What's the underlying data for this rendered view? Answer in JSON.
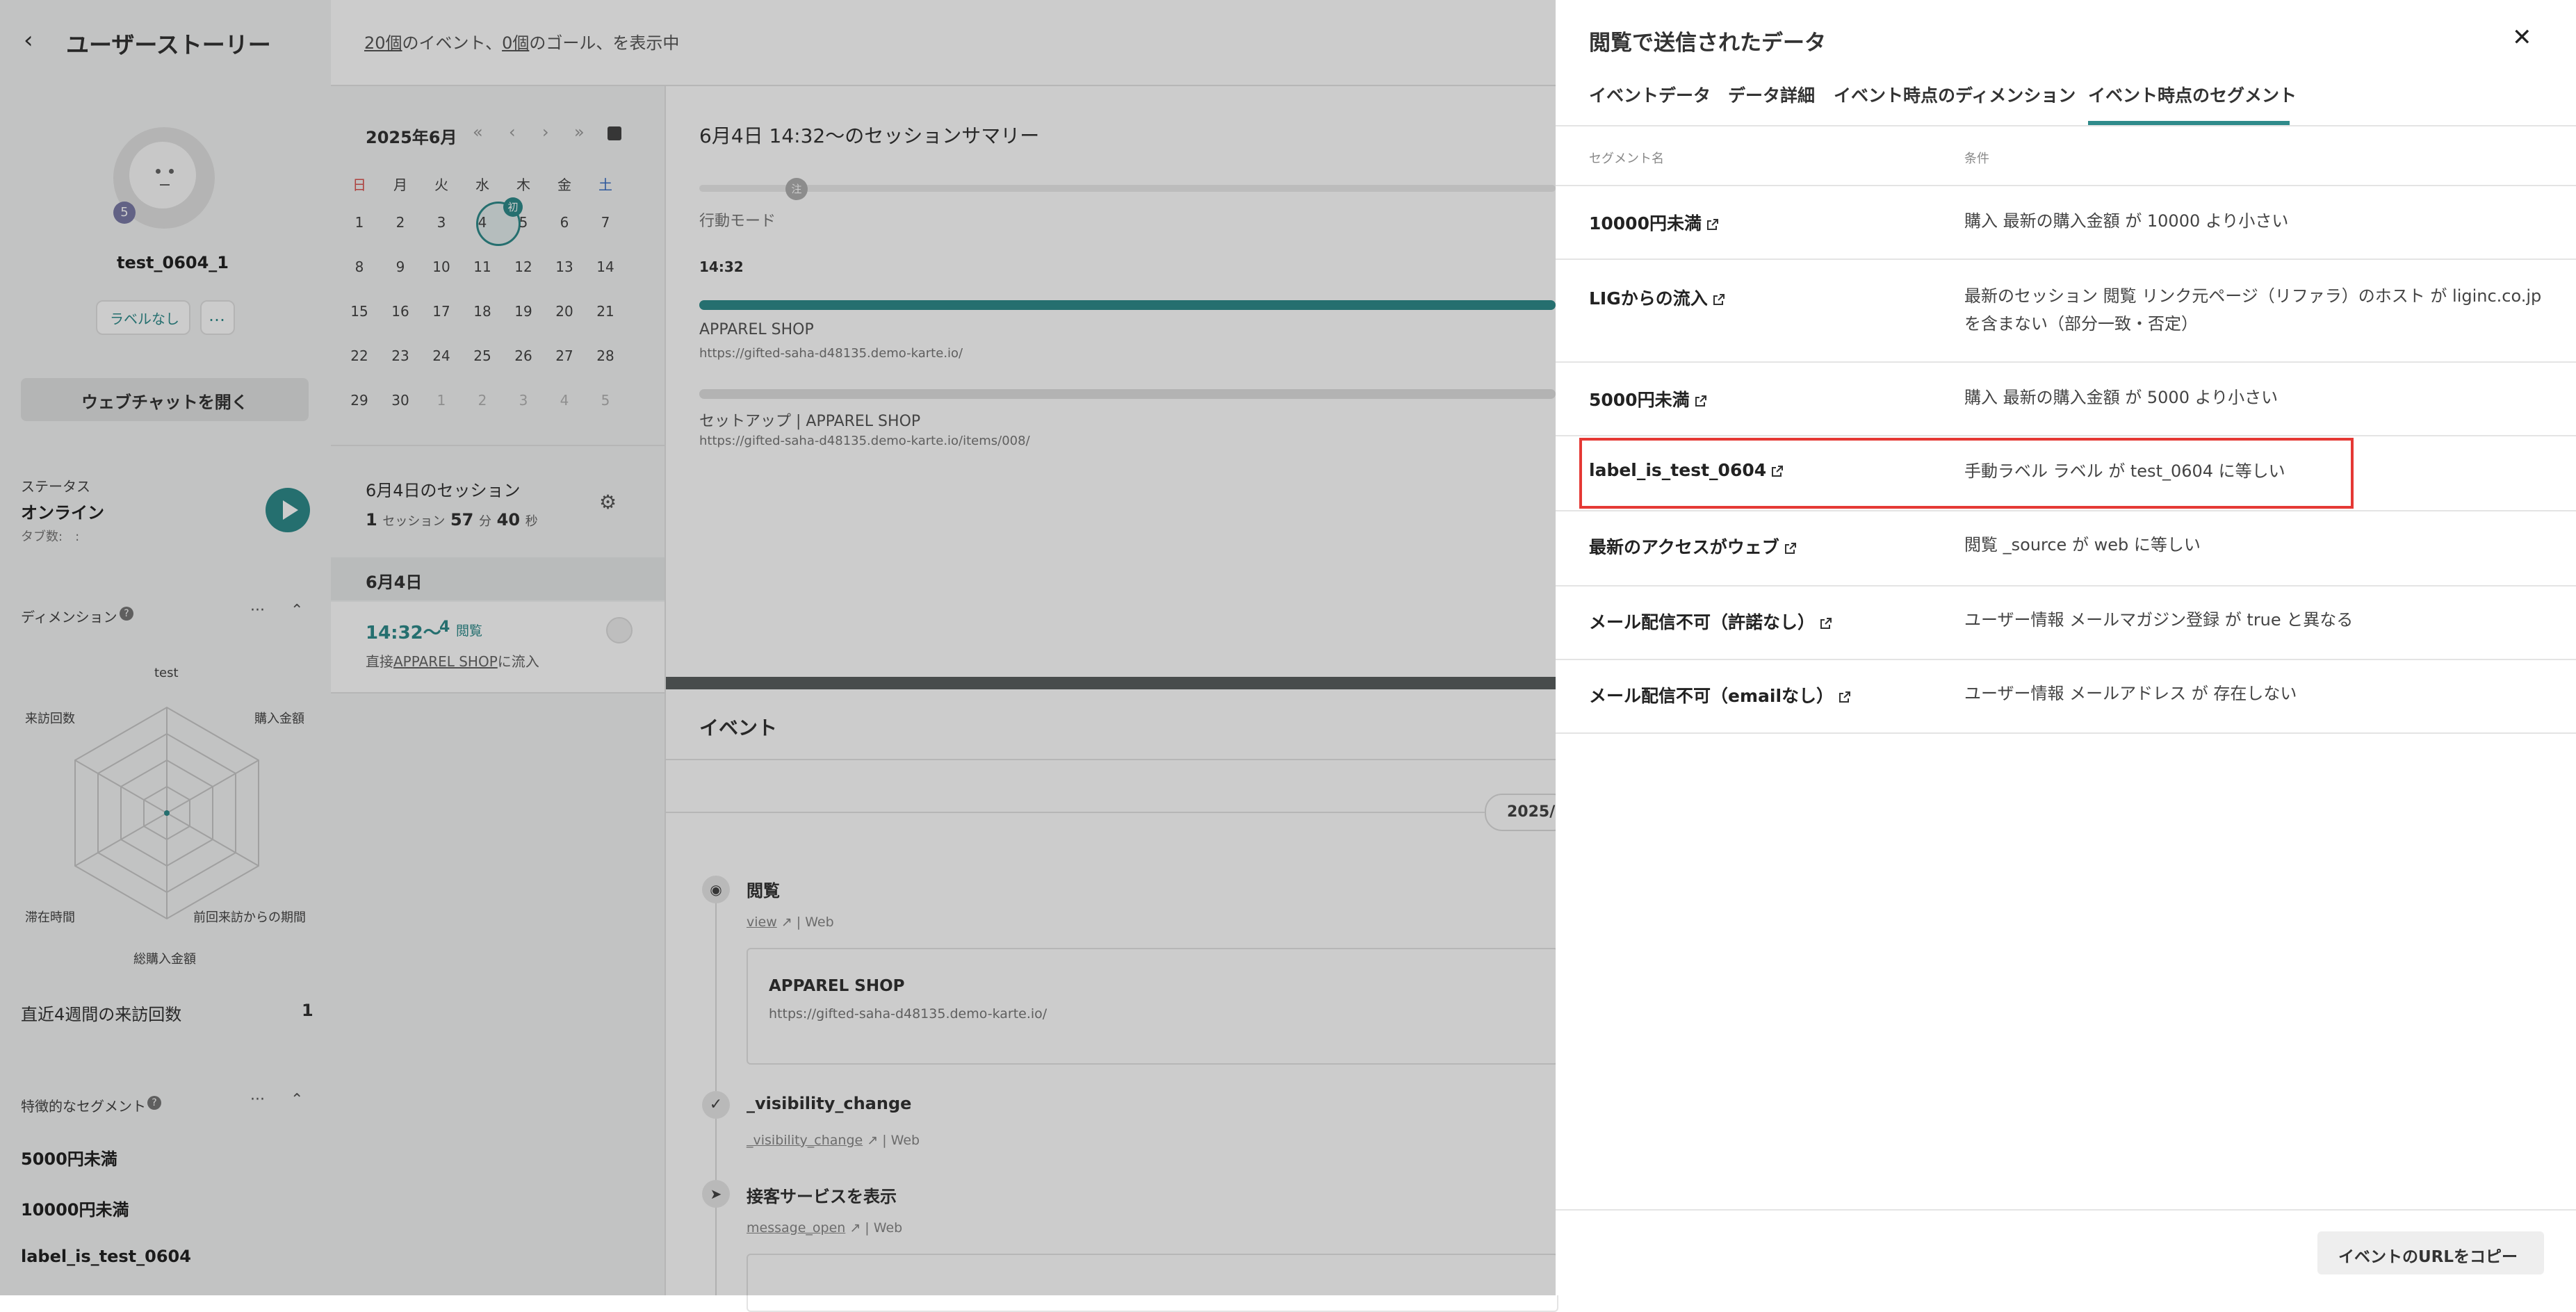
{
  "sidebar": {
    "title": "ユーザーストーリー",
    "user_badge": "5",
    "user_name": "test_0604_1",
    "label_chip": "ラベルなし",
    "more_chip": "…",
    "webchat_button": "ウェブチャットを開く",
    "status_label": "ステータス",
    "status_value": "オンライン",
    "tab_count": "タブ数:　:",
    "dimension_label": "ディメンション",
    "radar_labels": [
      "test",
      "購入金額",
      "前回来訪からの期間",
      "総購入金額",
      "滞在時間",
      "来訪回数"
    ],
    "visits_label": "直近4週間の来訪回数",
    "visits_value": "1",
    "segments_label": "特徴的なセグメント",
    "segments": [
      "5000円未満",
      "10000円未満",
      "label_is_test_0604"
    ]
  },
  "header": {
    "events_count": "20個",
    "events_text": "のイベント、",
    "goals_count": "0個",
    "goals_text": "のゴール、を表示中"
  },
  "calendar": {
    "month": "2025年6月",
    "nav": [
      "«",
      "‹",
      "›",
      "»"
    ],
    "weekdays": [
      "日",
      "月",
      "火",
      "水",
      "木",
      "金",
      "土"
    ],
    "weeks": [
      [
        "1",
        "2",
        "3",
        "4",
        "5",
        "6",
        "7"
      ],
      [
        "8",
        "9",
        "10",
        "11",
        "12",
        "13",
        "14"
      ],
      [
        "15",
        "16",
        "17",
        "18",
        "19",
        "20",
        "21"
      ],
      [
        "22",
        "23",
        "24",
        "25",
        "26",
        "27",
        "28"
      ],
      [
        "29",
        "30",
        "1",
        "2",
        "3",
        "4",
        "5"
      ]
    ],
    "first_badge": "初",
    "session_title": "6月4日のセッション",
    "session_count": "1",
    "session_unit": "セッション",
    "duration_min": "57",
    "duration_min_unit": "分",
    "duration_sec": "40",
    "duration_sec_unit": "秒",
    "date_header": "6月4日",
    "session_time": "14:32〜",
    "session_views": "4",
    "session_views_unit": "閲覧",
    "session_source_prefix": "直接",
    "session_source_link": "APPAREL SHOP",
    "session_source_suffix": "に流入"
  },
  "summary": {
    "title": "6月4日 14:32〜のセッションサマリー",
    "mode_badge": "注",
    "mode_label": "行動モード",
    "time": "14:32",
    "page1_title": "APPAREL SHOP",
    "page1_url": "https://gifted-saha-d48135.demo-karte.io/",
    "page2_title": "セットアップ | APPAREL SHOP",
    "page2_url": "https://gifted-saha-d48135.demo-karte.io/items/008/"
  },
  "events": {
    "title": "イベント",
    "date_pill": "2025/",
    "items": [
      {
        "name": "閲覧",
        "link": "view",
        "channel": "Web"
      },
      {
        "name": "_visibility_change",
        "link": "_visibility_change",
        "channel": "Web"
      },
      {
        "name": "接客サービスを表示",
        "link": "message_open",
        "channel": "Web"
      }
    ],
    "card_title": "APPAREL SHOP",
    "card_url": "https://gifted-saha-d48135.demo-karte.io/"
  },
  "drawer": {
    "title": "閲覧で送信されたデータ",
    "tabs": [
      "イベントデータ",
      "データ詳細",
      "イベント時点のディメンション",
      "イベント時点のセグメント"
    ],
    "active_tab": 3,
    "col_name": "セグメント名",
    "col_cond": "条件",
    "rows": [
      {
        "name": "10000円未満",
        "cond": "購入 最新の購入金額 が 10000 より小さい"
      },
      {
        "name": "LIGからの流入",
        "cond": "最新のセッション 閲覧 リンク元ページ（リファラ）のホスト が liginc.co.jp",
        "cond2": "を含まない（部分一致・否定）"
      },
      {
        "name": "5000円未満",
        "cond": "購入 最新の購入金額 が 5000 より小さい"
      },
      {
        "name": "label_is_test_0604",
        "cond": "手動ラベル ラベル が test_0604 に等しい"
      },
      {
        "name": "最新のアクセスがウェブ",
        "cond": "閲覧 _source が web に等しい"
      },
      {
        "name": "メール配信不可（許諾なし）",
        "cond": "ユーザー情報 メールマガジン登録 が true と異なる"
      },
      {
        "name": "メール配信不可（emailなし）",
        "cond": "ユーザー情報 メールアドレス が 存在しない"
      }
    ],
    "copy_button": "イベントのURLをコピー",
    "highlight_color": "#e53935",
    "accent_color": "#2f8b8b"
  }
}
